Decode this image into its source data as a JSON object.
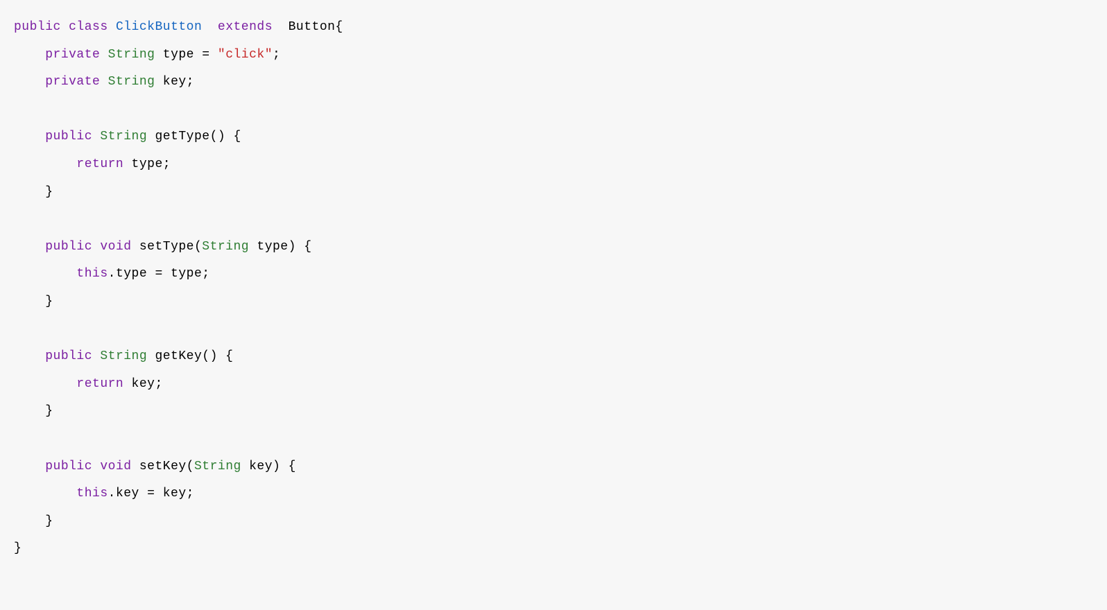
{
  "code": {
    "tokens": [
      {
        "text": "public",
        "class": "keyword"
      },
      {
        "text": " ",
        "class": ""
      },
      {
        "text": "class",
        "class": "keyword"
      },
      {
        "text": " ",
        "class": ""
      },
      {
        "text": "ClickButton",
        "class": "classname"
      },
      {
        "text": "  ",
        "class": ""
      },
      {
        "text": "extends",
        "class": "keyword"
      },
      {
        "text": "  Button{\n",
        "class": ""
      },
      {
        "text": "    ",
        "class": ""
      },
      {
        "text": "private",
        "class": "keyword"
      },
      {
        "text": " ",
        "class": ""
      },
      {
        "text": "String",
        "class": "type"
      },
      {
        "text": " type = ",
        "class": ""
      },
      {
        "text": "\"click\"",
        "class": "string"
      },
      {
        "text": ";\n",
        "class": ""
      },
      {
        "text": "    ",
        "class": ""
      },
      {
        "text": "private",
        "class": "keyword"
      },
      {
        "text": " ",
        "class": ""
      },
      {
        "text": "String",
        "class": "type"
      },
      {
        "text": " key;\n",
        "class": ""
      },
      {
        "text": "\n",
        "class": ""
      },
      {
        "text": "    ",
        "class": ""
      },
      {
        "text": "public",
        "class": "keyword"
      },
      {
        "text": " ",
        "class": ""
      },
      {
        "text": "String",
        "class": "type"
      },
      {
        "text": " getType() {\n",
        "class": ""
      },
      {
        "text": "        ",
        "class": ""
      },
      {
        "text": "return",
        "class": "keyword"
      },
      {
        "text": " type;\n",
        "class": ""
      },
      {
        "text": "    }\n",
        "class": ""
      },
      {
        "text": "\n",
        "class": ""
      },
      {
        "text": "    ",
        "class": ""
      },
      {
        "text": "public",
        "class": "keyword"
      },
      {
        "text": " ",
        "class": ""
      },
      {
        "text": "void",
        "class": "keyword"
      },
      {
        "text": " setType(",
        "class": ""
      },
      {
        "text": "String",
        "class": "type"
      },
      {
        "text": " type) {\n",
        "class": ""
      },
      {
        "text": "        ",
        "class": ""
      },
      {
        "text": "this",
        "class": "keyword"
      },
      {
        "text": ".type = type;\n",
        "class": ""
      },
      {
        "text": "    }\n",
        "class": ""
      },
      {
        "text": "\n",
        "class": ""
      },
      {
        "text": "    ",
        "class": ""
      },
      {
        "text": "public",
        "class": "keyword"
      },
      {
        "text": " ",
        "class": ""
      },
      {
        "text": "String",
        "class": "type"
      },
      {
        "text": " getKey() {\n",
        "class": ""
      },
      {
        "text": "        ",
        "class": ""
      },
      {
        "text": "return",
        "class": "keyword"
      },
      {
        "text": " key;\n",
        "class": ""
      },
      {
        "text": "    }\n",
        "class": ""
      },
      {
        "text": "\n",
        "class": ""
      },
      {
        "text": "    ",
        "class": ""
      },
      {
        "text": "public",
        "class": "keyword"
      },
      {
        "text": " ",
        "class": ""
      },
      {
        "text": "void",
        "class": "keyword"
      },
      {
        "text": " setKey(",
        "class": ""
      },
      {
        "text": "String",
        "class": "type"
      },
      {
        "text": " key) {\n",
        "class": ""
      },
      {
        "text": "        ",
        "class": ""
      },
      {
        "text": "this",
        "class": "keyword"
      },
      {
        "text": ".key = key;\n",
        "class": ""
      },
      {
        "text": "    }\n",
        "class": ""
      },
      {
        "text": "}",
        "class": ""
      }
    ]
  }
}
